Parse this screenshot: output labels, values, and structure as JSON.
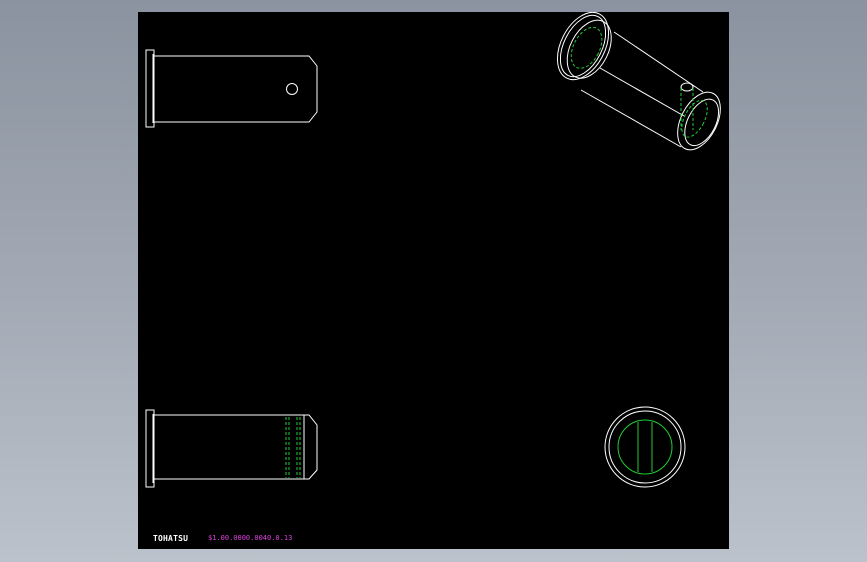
{
  "colors": {
    "background": "#000000",
    "edge": "#ffffff",
    "hidden_line": "#22cc33",
    "annotation": "#e040e0"
  },
  "title_block": {
    "brand": "TOHATSU",
    "part_number": "$1.00.0000.0040.0.13"
  },
  "views": [
    {
      "name": "front-view"
    },
    {
      "name": "isometric-view"
    },
    {
      "name": "top-view"
    },
    {
      "name": "end-view"
    }
  ]
}
